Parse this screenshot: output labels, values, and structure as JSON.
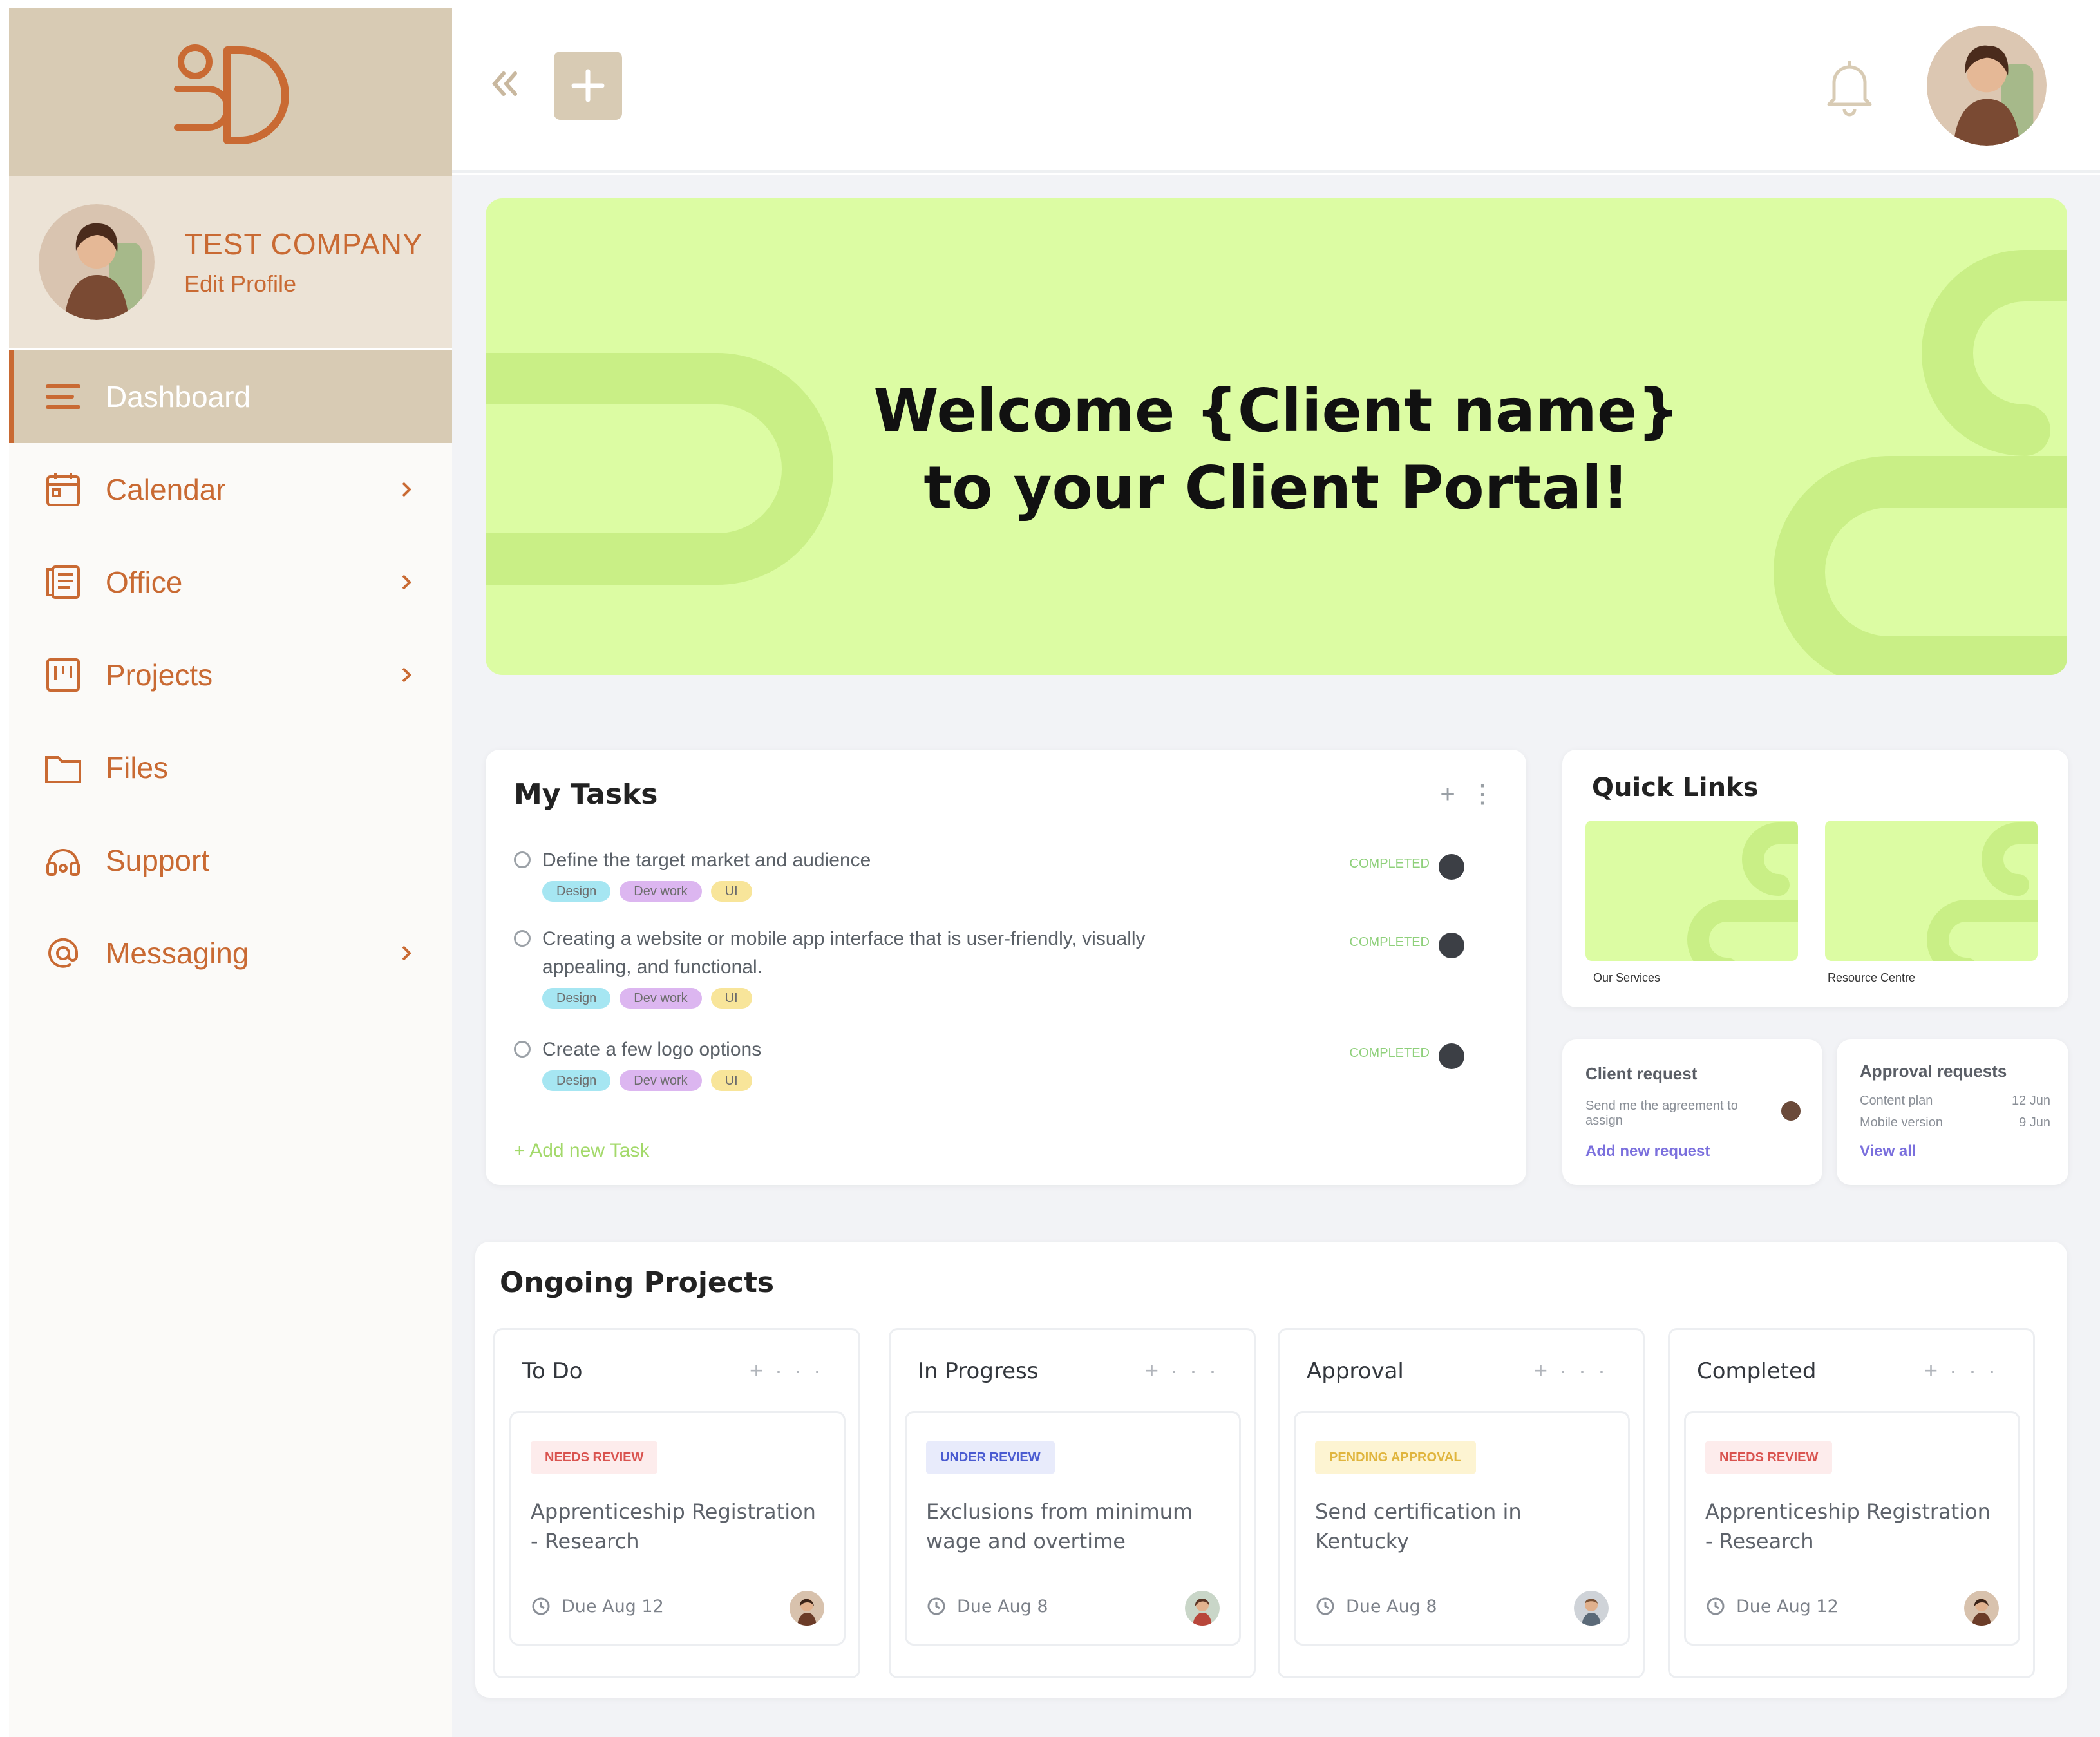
{
  "sidebar": {
    "company": "TEST COMPANY",
    "edit_profile": "Edit Profile",
    "items": [
      {
        "label": "Dashboard",
        "icon": "menu-icon",
        "active": true,
        "has_chevron": false
      },
      {
        "label": "Calendar",
        "icon": "calendar-icon",
        "has_chevron": true
      },
      {
        "label": "Office",
        "icon": "office-icon",
        "has_chevron": true
      },
      {
        "label": "Projects",
        "icon": "projects-icon",
        "has_chevron": true
      },
      {
        "label": "Files",
        "icon": "folder-icon",
        "has_chevron": false
      },
      {
        "label": "Support",
        "icon": "headset-icon",
        "has_chevron": false
      },
      {
        "label": "Messaging",
        "icon": "at-icon",
        "has_chevron": true
      }
    ]
  },
  "colors": {
    "accent": "#c96a33",
    "sidebar_brand": "#d8cbb4",
    "hero_green": "#dcfca3"
  },
  "hero": {
    "line1": "Welcome {Client name}",
    "line2": "to your Client Portal!"
  },
  "tasks": {
    "title": "My Tasks",
    "items": [
      {
        "text": "Define the target market and audience",
        "tags": [
          "Design",
          "Dev work",
          "UI"
        ],
        "status": "COMPLETED"
      },
      {
        "text": "Creating a website or mobile app interface that is user-friendly, visually appealing, and functional.",
        "tags": [
          "Design",
          "Dev work",
          "UI"
        ],
        "status": "COMPLETED"
      },
      {
        "text": "Create a few logo options",
        "tags": [
          "Design",
          "Dev work",
          "UI"
        ],
        "status": "COMPLETED"
      }
    ],
    "add_label": "+ Add new Task"
  },
  "quick_links": {
    "title": "Quick Links",
    "links": [
      "Our Services",
      "Resource Centre"
    ]
  },
  "client_request": {
    "title": "Client request",
    "item": "Send me the agreement to assign",
    "link": "Add new request"
  },
  "approval_requests": {
    "title": "Approval requests",
    "items": [
      {
        "label": "Content plan",
        "date": "12 Jun"
      },
      {
        "label": "Mobile version",
        "date": "9 Jun"
      }
    ],
    "link": "View all"
  },
  "projects": {
    "title": "Ongoing Projects",
    "columns": [
      {
        "name": "To Do",
        "badge": "NEEDS REVIEW",
        "badge_color": "red",
        "card_title": "Apprenticeship Registration - Research",
        "due": "Due Aug 12"
      },
      {
        "name": "In Progress",
        "badge": "UNDER REVIEW",
        "badge_color": "blue",
        "card_title": "Exclusions from minimum wage and overtime",
        "due": "Due Aug 8"
      },
      {
        "name": "Approval",
        "badge": "PENDING APPROVAL",
        "badge_color": "yellow",
        "card_title": "Send certification in Kentucky",
        "due": "Due Aug 8"
      },
      {
        "name": "Completed",
        "badge": "NEEDS REVIEW",
        "badge_color": "red",
        "card_title": "Apprenticeship Registration - Research",
        "due": "Due Aug 12"
      }
    ]
  }
}
